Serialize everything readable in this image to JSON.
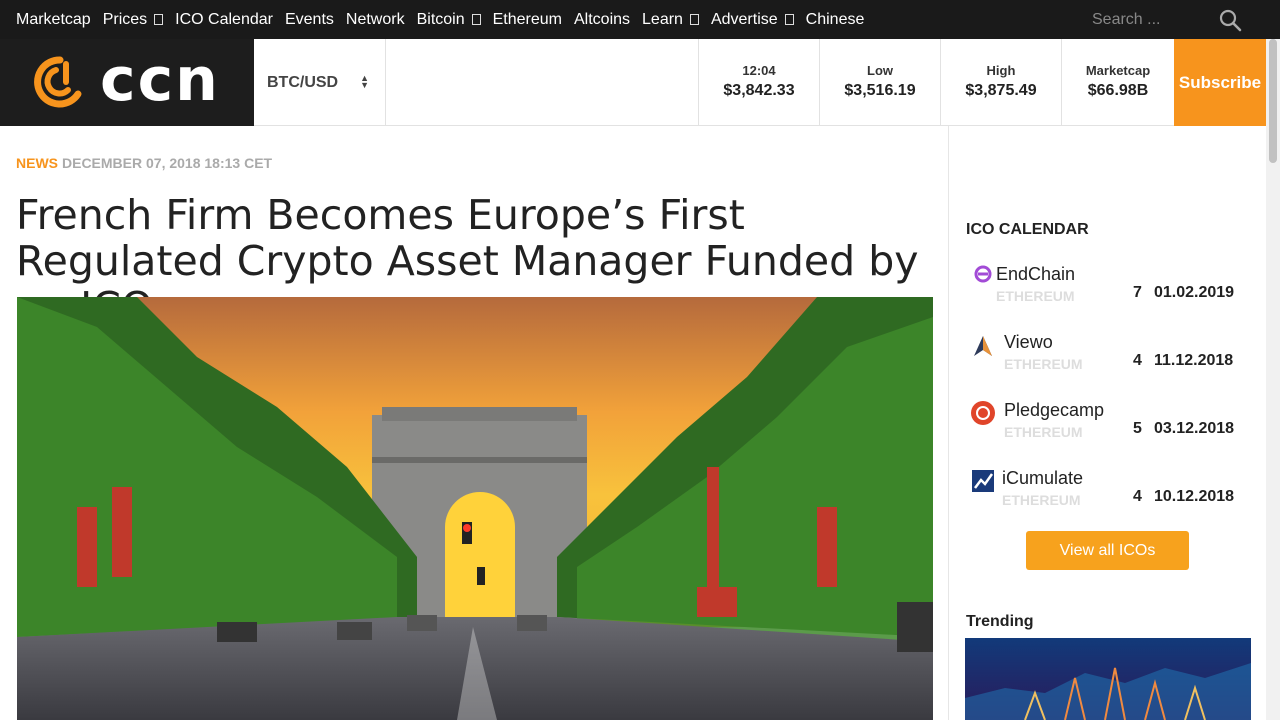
{
  "nav": {
    "items": [
      {
        "label": "Marketcap",
        "dropdown": false
      },
      {
        "label": "Prices",
        "dropdown": true
      },
      {
        "label": "ICO Calendar",
        "dropdown": false
      },
      {
        "label": "Events",
        "dropdown": false
      },
      {
        "label": "Network",
        "dropdown": false
      },
      {
        "label": "Bitcoin",
        "dropdown": true
      },
      {
        "label": "Ethereum",
        "dropdown": false
      },
      {
        "label": "Altcoins",
        "dropdown": false
      },
      {
        "label": "Learn",
        "dropdown": true
      },
      {
        "label": "Advertise",
        "dropdown": true
      },
      {
        "label": "Chinese",
        "dropdown": false
      }
    ],
    "search_placeholder": "Search ..."
  },
  "header": {
    "logo_text": "CCN",
    "pair": "BTC/USD",
    "stats": [
      {
        "label": "12:04",
        "value": "$3,842.33"
      },
      {
        "label": "Low",
        "value": "$3,516.19"
      },
      {
        "label": "High",
        "value": "$3,875.49"
      },
      {
        "label": "Marketcap",
        "value": "$66.98B"
      }
    ],
    "subscribe_label": "Subscribe"
  },
  "article": {
    "category": "NEWS",
    "date": "DECEMBER 07, 2018 18:13 CET",
    "title": "French Firm Becomes Europe’s First Regulated Crypto Asset Manager Funded by an ICO"
  },
  "sidebar": {
    "ico_heading": "ICO CALENDAR",
    "icos": [
      {
        "name": "EndChain",
        "chain": "ETHEREUM",
        "count": "7",
        "date": "01.02.2019",
        "icon": "endchain-icon"
      },
      {
        "name": "Viewo",
        "chain": "ETHEREUM",
        "count": "4",
        "date": "11.12.2018",
        "icon": "viewo-icon"
      },
      {
        "name": "Pledgecamp",
        "chain": "ETHEREUM",
        "count": "5",
        "date": "03.12.2018",
        "icon": "pledgecamp-icon"
      },
      {
        "name": "iCumulate",
        "chain": "ETHEREUM",
        "count": "4",
        "date": "10.12.2018",
        "icon": "icumulate-icon"
      }
    ],
    "view_all_label": "View all ICOs",
    "trending_heading": "Trending"
  },
  "colors": {
    "accent": "#f7941d",
    "nav_bg": "#1a1a1a"
  }
}
